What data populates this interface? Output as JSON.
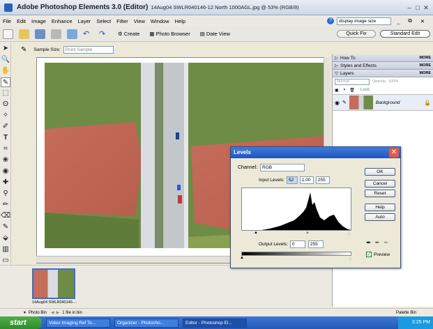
{
  "title": {
    "app": "Adobe Photoshop Elements 3.0 (Editor)",
    "file": "14Aug04 SWLR040146-12 North 1000AGL.jpg @ 53% (RGB/8)"
  },
  "menu": [
    "File",
    "Edit",
    "Image",
    "Enhance",
    "Layer",
    "Select",
    "Filter",
    "View",
    "Window",
    "Help"
  ],
  "help_search": {
    "value": "display image size"
  },
  "toolbar": {
    "create": "Create",
    "photo_browser": "Photo Browser",
    "date_view": "Date View",
    "quick_fix": "Quick Fix",
    "standard_edit": "Standard Edit"
  },
  "options": {
    "sample_size_label": "Sample Size:",
    "sample_size_value": "Point Sample"
  },
  "palettes": {
    "how_to": "How To",
    "styles": "Styles and Effects",
    "layers": "Layers",
    "more": "MORE",
    "blend": "Normal",
    "opacity_label": "Opacity:",
    "opacity": "100%",
    "lock_label": "Lock:",
    "layer_name": "Background"
  },
  "levels": {
    "title": "Levels",
    "channel_label": "Channel:",
    "channel": "RGB",
    "input_label": "Input Levels:",
    "in_black": "52",
    "in_gamma": "1.00",
    "in_white": "255",
    "output_label": "Output Levels:",
    "out_black": "0",
    "out_white": "255",
    "ok": "OK",
    "cancel": "Cancel",
    "reset": "Reset",
    "help": "Help",
    "auto": "Auto",
    "preview": "Preview"
  },
  "bin": {
    "thumb_label": "14Aug04 SWLR040146-...",
    "bin_label": "Photo Bin",
    "count": "1 file in bin",
    "palette_bin": "Palette Bin"
  },
  "taskbar": {
    "start": "start",
    "tasks": [
      "Video Imaging Ref Te...",
      "Organizer - Photosho...",
      "Editor - Photoshop El..."
    ],
    "clock": "3:25 PM"
  }
}
